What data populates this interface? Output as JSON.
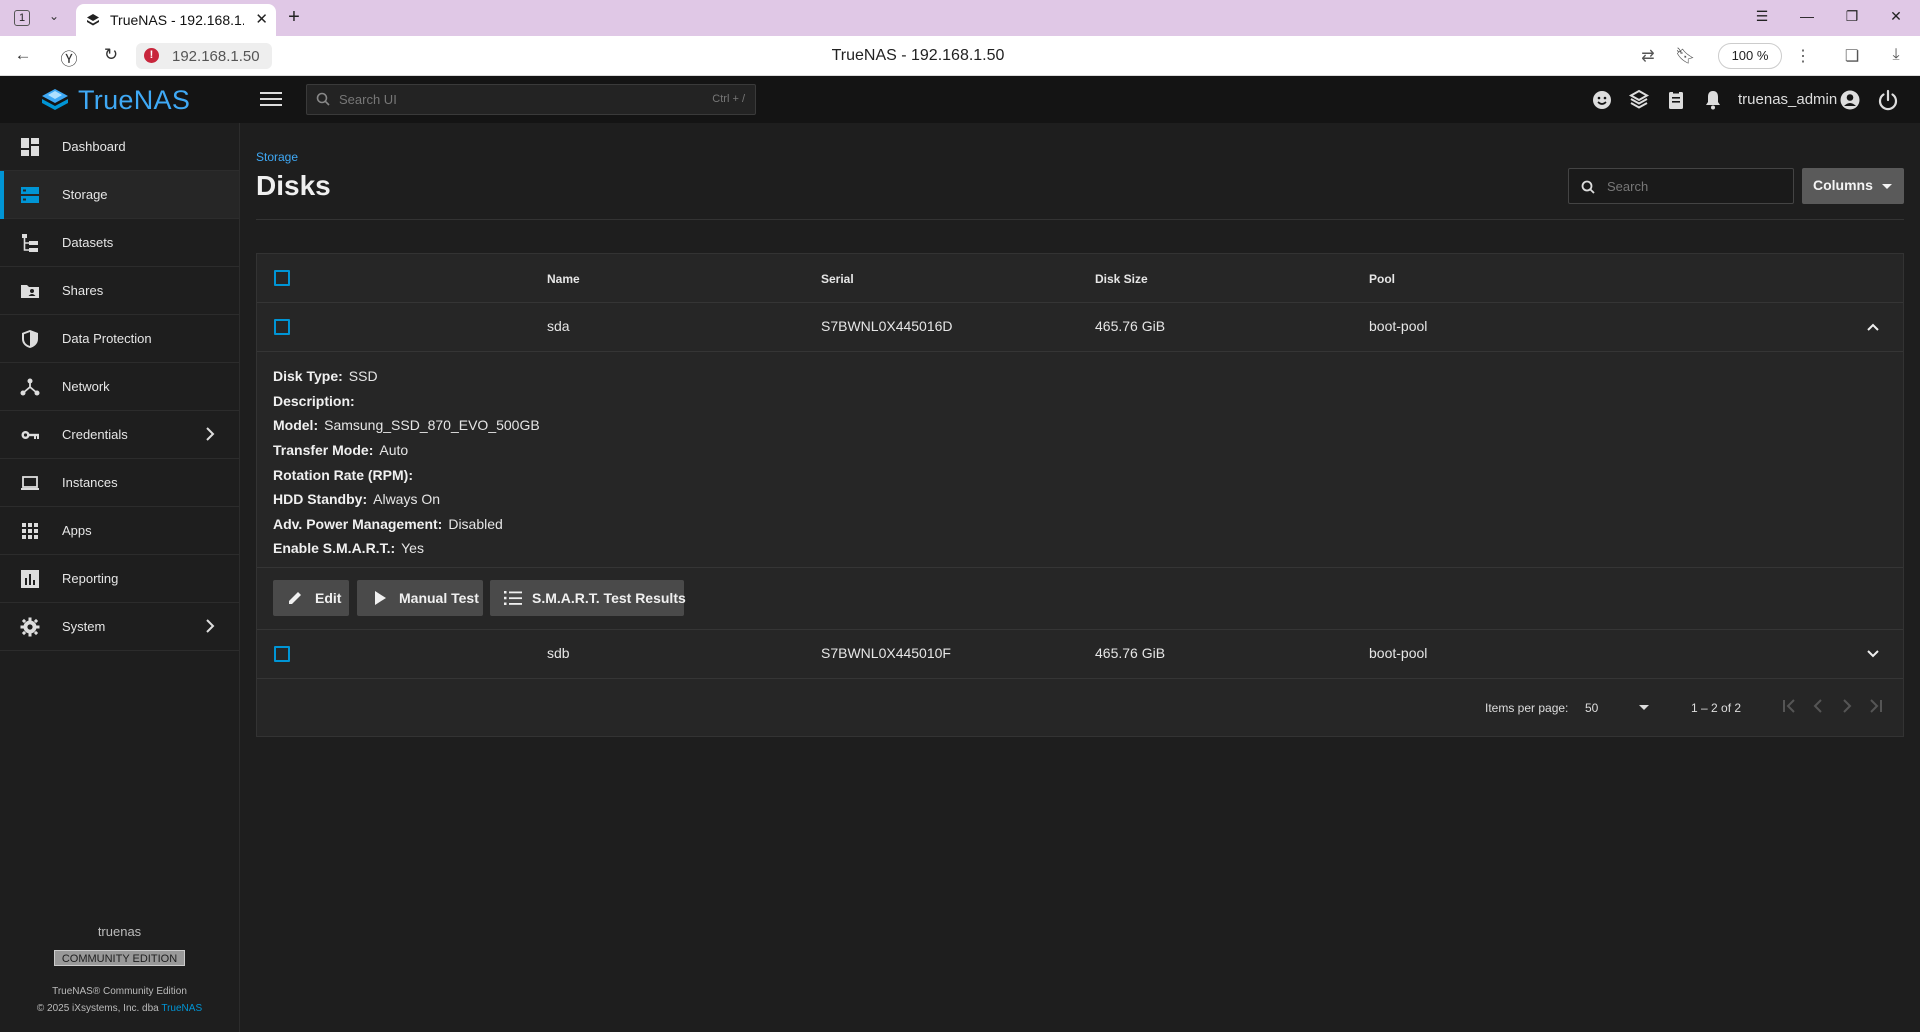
{
  "browser": {
    "tab_count": "1",
    "tab_title": "TrueNAS - 192.168.1.50",
    "url": "192.168.1.50",
    "page_title": "TrueNAS - 192.168.1.50",
    "zoom": "100 %"
  },
  "header": {
    "logo_text": "TrueNAS",
    "search_placeholder": "Search UI",
    "search_shortcut": "Ctrl + /",
    "username": "truenas_admin"
  },
  "sidebar": {
    "items": [
      {
        "label": "Dashboard",
        "icon": "dashboard-icon"
      },
      {
        "label": "Storage",
        "icon": "storage-icon"
      },
      {
        "label": "Datasets",
        "icon": "datasets-icon"
      },
      {
        "label": "Shares",
        "icon": "shares-icon"
      },
      {
        "label": "Data Protection",
        "icon": "shield-icon"
      },
      {
        "label": "Network",
        "icon": "network-icon"
      },
      {
        "label": "Credentials",
        "icon": "key-icon"
      },
      {
        "label": "Instances",
        "icon": "laptop-icon"
      },
      {
        "label": "Apps",
        "icon": "apps-icon"
      },
      {
        "label": "Reporting",
        "icon": "reporting-icon"
      },
      {
        "label": "System",
        "icon": "gear-icon"
      }
    ],
    "active": "Storage",
    "hostname": "truenas",
    "edition": "COMMUNITY EDITION",
    "copyright_line1": "TrueNAS® Community Edition",
    "copyright_line2": "© 2025 iXsystems, Inc. dba",
    "copyright_link": "TrueNAS"
  },
  "main": {
    "breadcrumb": "Storage",
    "title": "Disks",
    "search_placeholder": "Search",
    "columns_label": "Columns"
  },
  "table": {
    "headers": [
      "Name",
      "Serial",
      "Disk Size",
      "Pool"
    ],
    "rows": [
      {
        "name": "sda",
        "serial": "S7BWNL0X445016D",
        "size": "465.76 GiB",
        "pool": "boot-pool",
        "expanded": true
      },
      {
        "name": "sdb",
        "serial": "S7BWNL0X445010F",
        "size": "465.76 GiB",
        "pool": "boot-pool",
        "expanded": false
      }
    ],
    "details": [
      {
        "label": "Disk Type:",
        "value": "SSD"
      },
      {
        "label": "Description:",
        "value": ""
      },
      {
        "label": "Model:",
        "value": "Samsung_SSD_870_EVO_500GB"
      },
      {
        "label": "Transfer Mode:",
        "value": "Auto"
      },
      {
        "label": "Rotation Rate (RPM):",
        "value": ""
      },
      {
        "label": "HDD Standby:",
        "value": "Always On"
      },
      {
        "label": "Adv. Power Management:",
        "value": "Disabled"
      },
      {
        "label": "Enable S.M.A.R.T.:",
        "value": "Yes"
      }
    ],
    "actions": {
      "edit": "Edit",
      "manual_test": "Manual Test",
      "smart_results": "S.M.A.R.T. Test Results"
    },
    "pagination": {
      "items_per_page_label": "Items per page:",
      "items_per_page": "50",
      "range": "1 – 2 of 2"
    }
  },
  "colors": {
    "accent": "#0095d5",
    "logo": "#3fa9f5",
    "background": "#1e1e1e",
    "header": "#141414"
  }
}
